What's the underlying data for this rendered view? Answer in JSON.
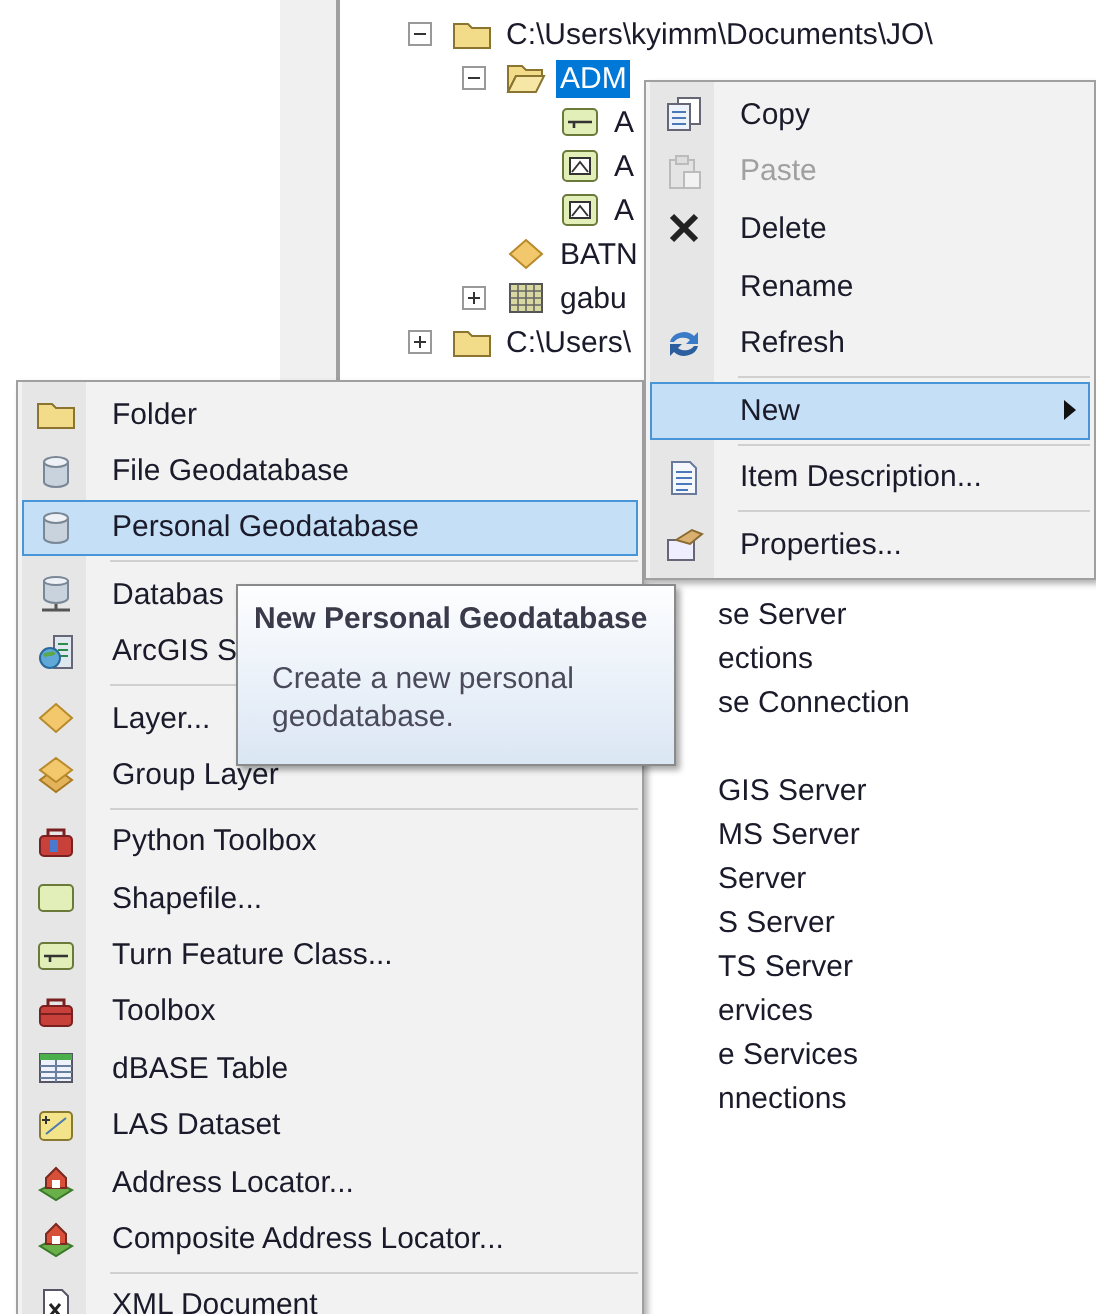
{
  "tree": [
    {
      "label": "C:\\Users\\kyimm\\Documents\\JO\\",
      "kind": "folder",
      "expanded": true,
      "selected": false,
      "children": [
        {
          "label": "ADM",
          "kind": "folder-open",
          "expanded": true,
          "selected": true,
          "children": [
            {
              "label": "A",
              "kind": "line-fc",
              "selected": false
            },
            {
              "label": "A",
              "kind": "polygon-fc",
              "selected": false
            },
            {
              "label": "A",
              "kind": "polygon-fc",
              "selected": false
            }
          ]
        },
        {
          "label": "BATN",
          "kind": "layer",
          "selected": false
        },
        {
          "label": "gabu",
          "kind": "raster",
          "expanded": false,
          "selected": false
        }
      ]
    },
    {
      "label": "C:\\Users\\",
      "kind": "folder",
      "expanded": false,
      "selected": false
    }
  ],
  "tree_lower_group_1": [
    "se Server",
    "ections",
    "se Connection"
  ],
  "tree_lower_group_2": [
    "GIS Server",
    "MS Server",
    "Server",
    "S Server",
    "TS Server",
    "ervices",
    "e Services",
    "nnections"
  ],
  "context_menu": {
    "items": [
      {
        "kind": "copy",
        "label": "Copy",
        "disabled": false,
        "selected": false
      },
      {
        "kind": "paste",
        "label": "Paste",
        "disabled": true,
        "selected": false
      },
      {
        "kind": "delete",
        "label": "Delete",
        "disabled": false,
        "selected": false
      },
      {
        "kind": "plain",
        "label": "Rename",
        "disabled": false,
        "selected": false
      },
      {
        "kind": "refresh",
        "label": "Refresh",
        "disabled": false,
        "selected": false
      },
      {
        "kind": "separator"
      },
      {
        "kind": "plain",
        "label": "New",
        "disabled": false,
        "selected": true,
        "submenu": true
      },
      {
        "kind": "separator"
      },
      {
        "kind": "document",
        "label": "Item Description...",
        "disabled": false,
        "selected": false
      },
      {
        "kind": "separator"
      },
      {
        "kind": "properties",
        "label": "Properties...",
        "disabled": false,
        "selected": false
      }
    ]
  },
  "new_submenu": {
    "items": [
      {
        "kind": "folder",
        "label": "Folder",
        "selected": false
      },
      {
        "kind": "database",
        "label": "File Geodatabase",
        "selected": false
      },
      {
        "kind": "database",
        "label": "Personal Geodatabase",
        "selected": true
      },
      {
        "kind": "separator"
      },
      {
        "kind": "server-database",
        "label": "Databas",
        "selected": false
      },
      {
        "kind": "globe-server",
        "label": "ArcGIS S",
        "selected": false
      },
      {
        "kind": "separator"
      },
      {
        "kind": "layer",
        "label": "Layer...",
        "selected": false
      },
      {
        "kind": "group-layer",
        "label": "Group Layer",
        "selected": false
      },
      {
        "kind": "separator"
      },
      {
        "kind": "python-toolbox",
        "label": "Python Toolbox",
        "selected": false
      },
      {
        "kind": "shapefile",
        "label": "Shapefile...",
        "selected": false
      },
      {
        "kind": "line-fc",
        "label": "Turn Feature Class...",
        "selected": false
      },
      {
        "kind": "toolbox",
        "label": "Toolbox",
        "selected": false
      },
      {
        "kind": "table",
        "label": "dBASE Table",
        "selected": false
      },
      {
        "kind": "las",
        "label": "LAS Dataset",
        "selected": false
      },
      {
        "kind": "house",
        "label": "Address Locator...",
        "selected": false
      },
      {
        "kind": "house",
        "label": "Composite Address Locator...",
        "selected": false
      },
      {
        "kind": "separator"
      },
      {
        "kind": "xml",
        "label": "XML Document",
        "selected": false
      }
    ]
  },
  "tooltip": {
    "title": "New Personal Geodatabase",
    "body": "Create a new personal geodatabase."
  }
}
